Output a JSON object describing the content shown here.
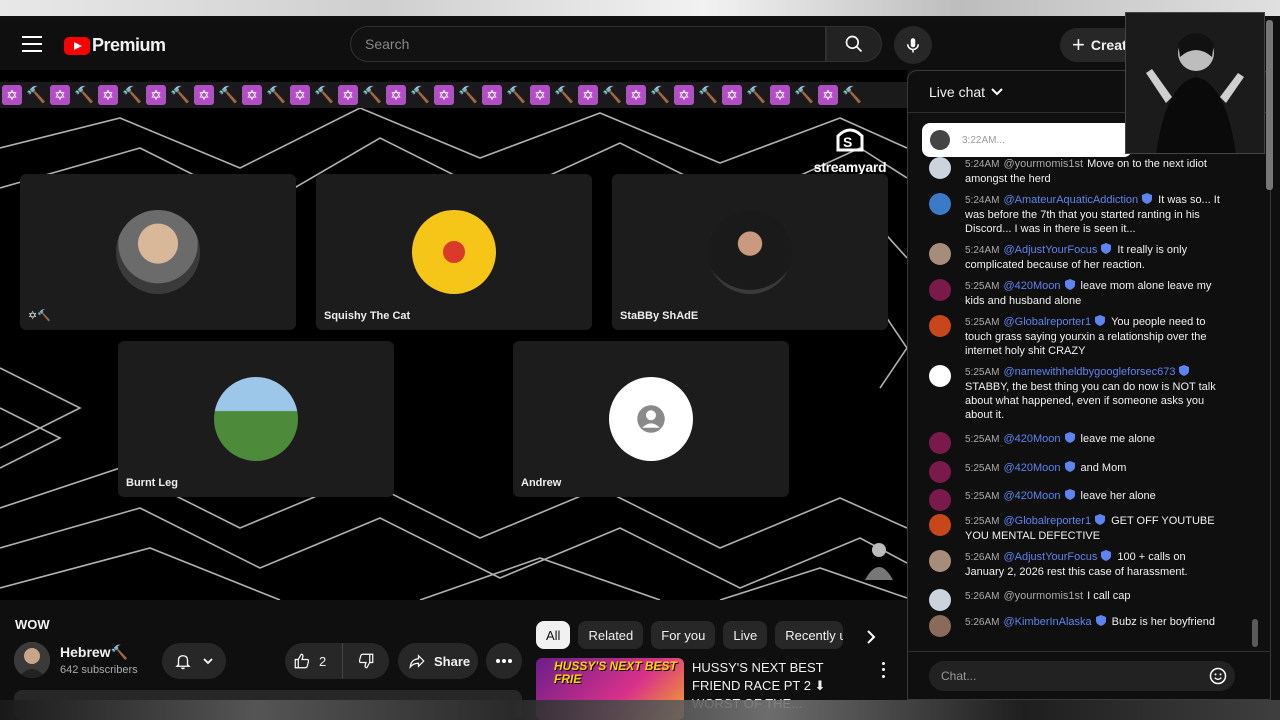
{
  "header": {
    "logo_text": "Premium",
    "search_placeholder": "Search",
    "create_label": "Create"
  },
  "video": {
    "watermark": "streamyard",
    "emoji_strip": [
      "✡",
      "🔨"
    ],
    "participants": [
      {
        "name": "✡🔨"
      },
      {
        "name": "Squishy The Cat"
      },
      {
        "name": "StaBBy ShAdE"
      },
      {
        "name": "Burnt Leg"
      },
      {
        "name": "Andrew"
      }
    ]
  },
  "info": {
    "title": "WOW",
    "channel_name": "Hebrew🔨",
    "subscribers": "642 subscribers",
    "likes": "2",
    "share_label": "Share"
  },
  "chips": [
    "All",
    "Related",
    "For you",
    "Live",
    "Recently uploaded"
  ],
  "recommendation": {
    "title": "HUSSY'S NEXT BEST FRIEND RACE PT 2 ⬇ WORST OF THE...",
    "thumb_text": "HUSSY'S NEXT BEST FRIE"
  },
  "chat": {
    "header": "Live chat",
    "pinned_time": "3:22AM...",
    "input_placeholder": "Chat...",
    "messages": [
      {
        "time": "5:24AM",
        "author": "@yourmomis1st",
        "member": false,
        "text": "Move on to the next idiot amongst the herd",
        "av": "#c9d4dc"
      },
      {
        "time": "5:24AM",
        "author": "@AmateurAquaticAddiction",
        "member": true,
        "text": "It was so... It was before the 7th that you started ranting in his Discord... I was in there is seen it...",
        "av": "#3a7ac7"
      },
      {
        "time": "5:24AM",
        "author": "@AdjustYourFocus",
        "member": true,
        "text": "It really is only complicated because of her reaction.",
        "av": "#a88c7a"
      },
      {
        "time": "5:25AM",
        "author": "@420Moon",
        "member": true,
        "text": "leave mom alone leave my kids and husband alone",
        "av": "#7a1a4a"
      },
      {
        "time": "5:25AM",
        "author": "@Globalreporter1",
        "member": true,
        "text": "You people need to touch grass saying yourxin a relationship over the internet holy shit CRAZY",
        "av": "#c8471a"
      },
      {
        "time": "5:25AM",
        "author": "@namewithheldbygoogleforsec673",
        "member": true,
        "text": "STABBY, the best thing you can do now is NOT talk about what happened, even if someone asks you about it.",
        "av": "#ffffff"
      },
      {
        "time": "5:25AM",
        "author": "@420Moon",
        "member": true,
        "text": "leave me alone",
        "av": "#7a1a4a"
      },
      {
        "time": "5:25AM",
        "author": "@420Moon",
        "member": true,
        "text": "and Mom",
        "av": "#7a1a4a"
      },
      {
        "time": "5:25AM",
        "author": "@420Moon",
        "member": true,
        "text": "leave her alone",
        "av": "#7a1a4a"
      },
      {
        "time": "5:25AM",
        "author": "@Globalreporter1",
        "member": true,
        "text": "GET OFF YOUTUBE YOU MENTAL DEFECTIVE",
        "av": "#c8471a"
      },
      {
        "time": "5:26AM",
        "author": "@AdjustYourFocus",
        "member": true,
        "text": "100 + calls on January 2, 2026 rest this case of harassment.",
        "av": "#a88c7a"
      },
      {
        "time": "5:26AM",
        "author": "@yourmomis1st",
        "member": false,
        "text": "I call cap",
        "av": "#c9d4dc"
      },
      {
        "time": "5:26AM",
        "author": "@KimberInAlaska",
        "member": true,
        "text": "Bubz is her boyfriend",
        "av": "#8a6a5a"
      }
    ]
  },
  "colors": {
    "accent": "#ff0000",
    "member_name": "#5e84f1",
    "background": "#0f0f0f"
  }
}
